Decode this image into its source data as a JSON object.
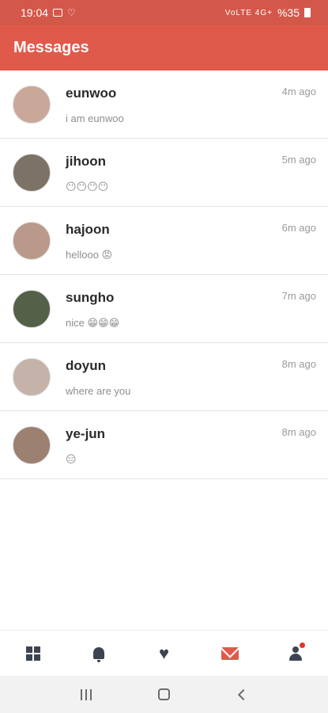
{
  "status_bar": {
    "time": "19:04",
    "signal_text": "VoLTE 4G+",
    "battery": "%35"
  },
  "app_bar": {
    "title": "Messages"
  },
  "messages": [
    {
      "name": "eunwoo",
      "preview": "i am eunwoo",
      "time": "4m ago",
      "avatar_color": "#c9a89a"
    },
    {
      "name": "jihoon",
      "preview": "😶😶😶😶",
      "time": "5m ago",
      "avatar_color": "#7d7266"
    },
    {
      "name": "hajoon",
      "preview": "hellooo 😡",
      "time": "6m ago",
      "avatar_color": "#b99a8a"
    },
    {
      "name": "sungho",
      "preview": "nice 😁😁😁",
      "time": "7m ago",
      "avatar_color": "#556048"
    },
    {
      "name": "doyun",
      "preview": "where are you",
      "time": "8m ago",
      "avatar_color": "#c5b3aa"
    },
    {
      "name": "ye-jun",
      "preview": "😑",
      "time": "8m ago",
      "avatar_color": "#9c8070"
    }
  ],
  "bottom_nav": {
    "items": [
      {
        "icon": "grid-icon"
      },
      {
        "icon": "bell-icon"
      },
      {
        "icon": "heart-icon"
      },
      {
        "icon": "mail-icon",
        "active": true,
        "color": "#e05a4c"
      },
      {
        "icon": "user-icon",
        "badge": true
      }
    ]
  },
  "colors": {
    "primary": "#e05a4c",
    "status_bar": "#d4584a",
    "inactive_icon": "#3c4450"
  }
}
